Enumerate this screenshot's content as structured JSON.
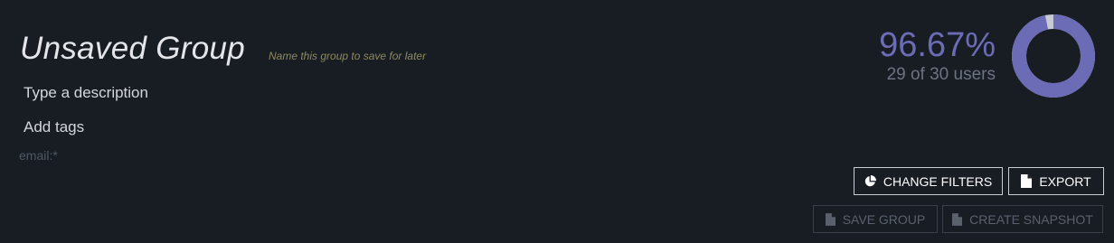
{
  "group": {
    "name": "Unsaved Group",
    "name_hint": "Name this group to save for later",
    "description_placeholder": "Type a description",
    "tags_placeholder": "Add tags",
    "filter": "email:*"
  },
  "stats": {
    "percent": "96.67%",
    "user_count": "29 of 30 users",
    "fraction": 0.9667,
    "accent_color": "#6b6bb6"
  },
  "actions": {
    "change_filters": {
      "label": "CHANGE FILTERS",
      "icon": "pie-chart-icon"
    },
    "export": {
      "label": "EXPORT",
      "icon": "document-icon"
    },
    "save_group": {
      "label": "SAVE GROUP",
      "icon": "document-icon",
      "disabled": true
    },
    "create_snapshot": {
      "label": "CREATE SNAPSHOT",
      "icon": "document-icon",
      "disabled": true
    }
  }
}
